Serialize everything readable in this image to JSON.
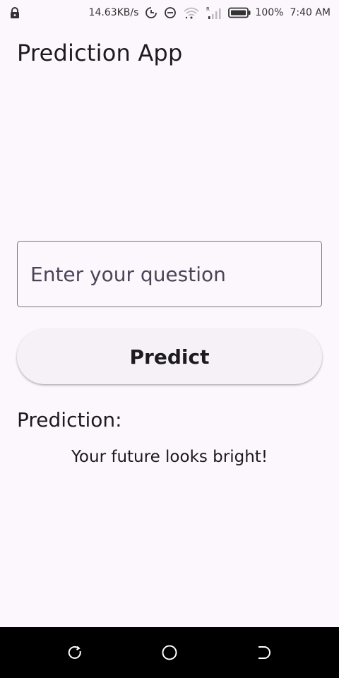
{
  "status_bar": {
    "network_speed": "14.63KB/s",
    "battery_percent": "100%",
    "time": "7:40 AM",
    "icons": [
      "lock-icon",
      "data-saver-icon",
      "do-not-disturb-icon",
      "wifi-icon",
      "signal-icon",
      "battery-icon"
    ]
  },
  "app": {
    "title": "Prediction App"
  },
  "question_input": {
    "placeholder": "Enter your question",
    "value": ""
  },
  "predict_button": {
    "label": "Predict"
  },
  "prediction": {
    "label": "Prediction:",
    "result": "Your future looks bright!"
  },
  "nav_bar": {
    "icons": [
      "recents-icon",
      "home-icon",
      "back-icon"
    ]
  },
  "colors": {
    "background": "#FCF7FC",
    "button_background": "#F6F1F6",
    "outline": "#79747E",
    "text": "#1D1B20",
    "nav_bar": "#000000"
  }
}
